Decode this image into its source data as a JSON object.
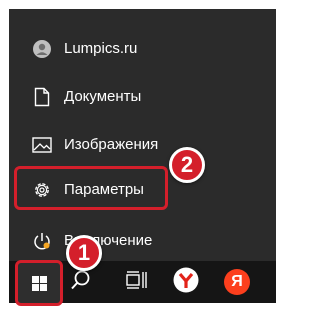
{
  "start_menu": {
    "items": [
      {
        "label": "Lumpics.ru",
        "icon": "user-avatar-icon"
      },
      {
        "label": "Документы",
        "icon": "document-icon"
      },
      {
        "label": "Изображения",
        "icon": "image-icon"
      },
      {
        "label": "Параметры",
        "icon": "gear-icon"
      },
      {
        "label": "Выключение",
        "icon": "power-icon"
      }
    ]
  },
  "taskbar": {
    "buttons": [
      {
        "name": "start",
        "icon": "windows-logo-icon"
      },
      {
        "name": "search",
        "icon": "search-icon"
      },
      {
        "name": "task-view",
        "icon": "task-view-icon"
      },
      {
        "name": "yandex-browser",
        "icon": "yandex-browser-icon"
      },
      {
        "name": "yandex",
        "icon": "yandex-icon",
        "glyph": "Я"
      }
    ]
  },
  "annotations": [
    {
      "number": "1"
    },
    {
      "number": "2"
    }
  ],
  "colors": {
    "menu_bg": "#2b2b2b",
    "taskbar_bg": "#151515",
    "highlight": "#d41f2b",
    "yandex_red": "#fc3f1d"
  }
}
